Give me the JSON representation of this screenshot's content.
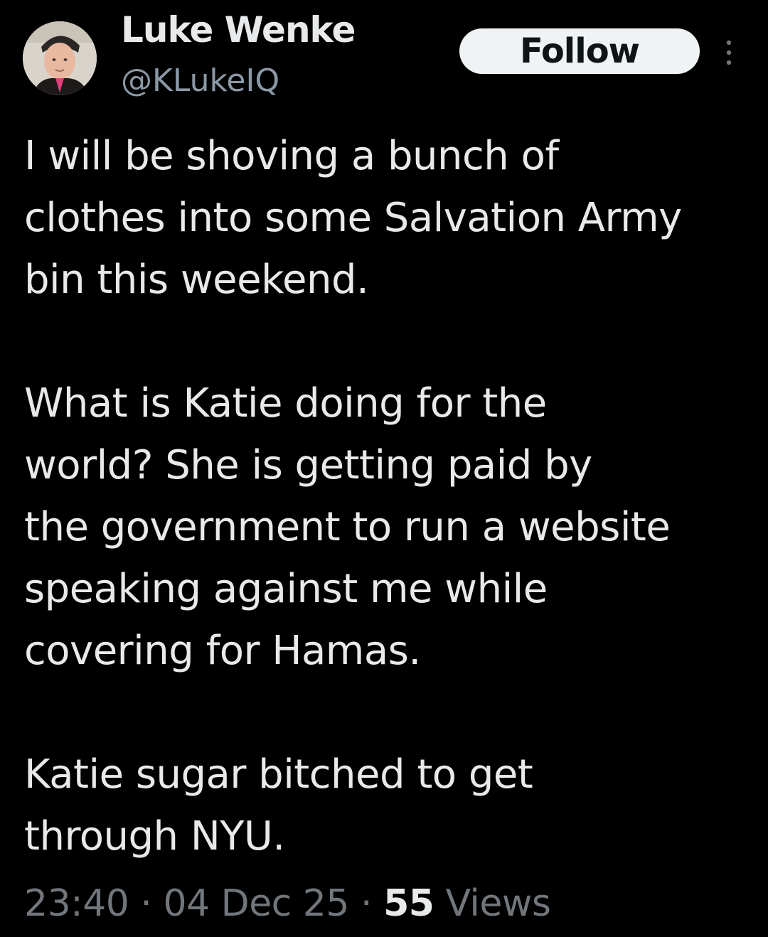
{
  "author": {
    "display_name": "Luke Wenke",
    "handle": "@KLukeIQ",
    "avatar_icon": "profile-photo"
  },
  "follow_label": "Follow",
  "more_icon": "more-options-icon",
  "tweet": {
    "paragraphs": [
      {
        "lines": [
          "I will be shoving a bunch of",
          "clothes into some Salvation Army",
          "bin this weekend."
        ]
      },
      {
        "lines": [
          "What is Katie doing for the",
          "world?  She is getting paid by",
          "the government to run a website",
          "speaking against me while",
          "covering for Hamas."
        ]
      },
      {
        "lines": [
          "Katie sugar bitched to get",
          "through NYU."
        ]
      }
    ]
  },
  "meta": {
    "time": "23:40",
    "separator": " · ",
    "date": "04 Dec 25",
    "views_count": "55",
    "views_label": " Views"
  },
  "colors": {
    "background": "#000000",
    "primary_text": "#e7e9ea",
    "secondary_text": "#71767b",
    "follow_bg": "#eff3f4",
    "follow_text": "#0f1419"
  }
}
